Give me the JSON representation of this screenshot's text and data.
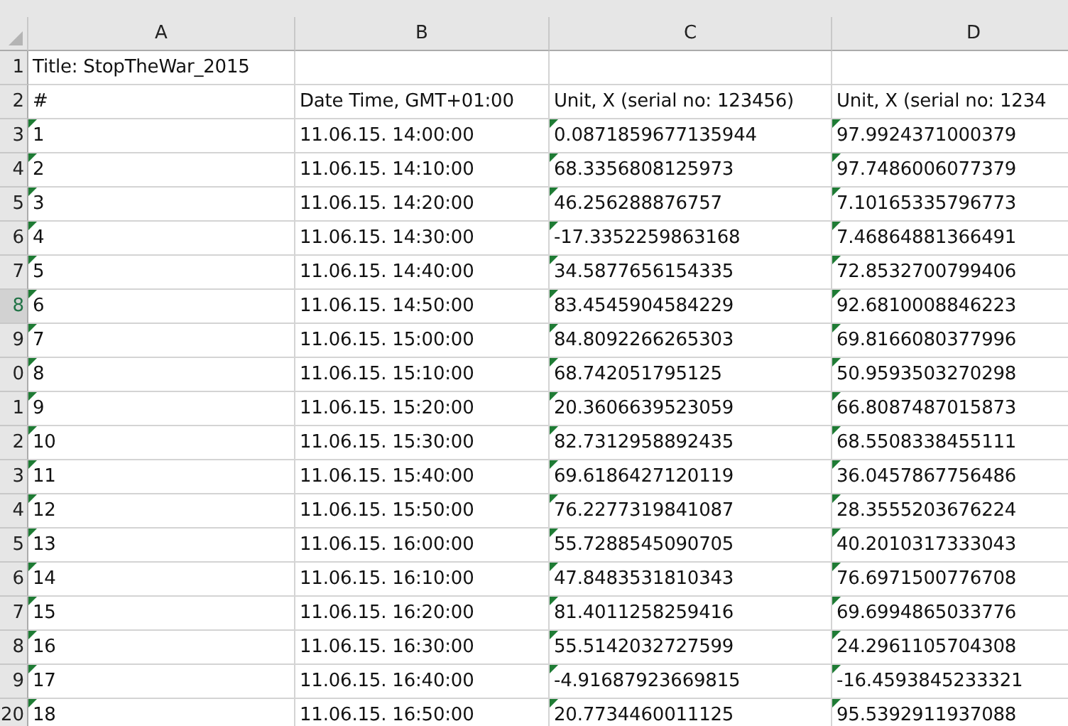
{
  "columns": [
    {
      "label": "A"
    },
    {
      "label": "B"
    },
    {
      "label": "C"
    },
    {
      "label": "D"
    }
  ],
  "rows": [
    {
      "header": "1",
      "selected": false,
      "flagged": false,
      "cells": [
        "Title: StopTheWar_2015",
        "",
        "",
        ""
      ]
    },
    {
      "header": "2",
      "selected": false,
      "flagged": false,
      "cells": [
        "#",
        "Date Time, GMT+01:00",
        "Unit, X (serial no: 123456)",
        "Unit, X (serial no: 1234"
      ]
    },
    {
      "header": "3",
      "selected": false,
      "flagged": true,
      "cells": [
        "1",
        "11.06.15. 14:00:00",
        "0.0871859677135944",
        "97.9924371000379"
      ]
    },
    {
      "header": "4",
      "selected": false,
      "flagged": true,
      "cells": [
        "2",
        "11.06.15. 14:10:00",
        "68.3356808125973",
        "97.7486006077379"
      ]
    },
    {
      "header": "5",
      "selected": false,
      "flagged": true,
      "cells": [
        "3",
        "11.06.15. 14:20:00",
        "46.256288876757",
        "7.10165335796773"
      ]
    },
    {
      "header": "6",
      "selected": false,
      "flagged": true,
      "cells": [
        "4",
        "11.06.15. 14:30:00",
        "-17.3352259863168",
        "7.46864881366491"
      ]
    },
    {
      "header": "7",
      "selected": false,
      "flagged": true,
      "cells": [
        "5",
        "11.06.15. 14:40:00",
        "34.5877656154335",
        "72.8532700799406"
      ]
    },
    {
      "header": "8",
      "selected": true,
      "flagged": true,
      "cells": [
        "6",
        "11.06.15. 14:50:00",
        "83.4545904584229",
        "92.6810008846223"
      ]
    },
    {
      "header": "9",
      "selected": false,
      "flagged": true,
      "cells": [
        "7",
        "11.06.15. 15:00:00",
        "84.8092266265303",
        "69.8166080377996"
      ]
    },
    {
      "header": "0",
      "selected": false,
      "flagged": true,
      "cells": [
        "8",
        "11.06.15. 15:10:00",
        "68.742051795125",
        "50.9593503270298"
      ]
    },
    {
      "header": "1",
      "selected": false,
      "flagged": true,
      "cells": [
        "9",
        "11.06.15. 15:20:00",
        "20.3606639523059",
        "66.8087487015873"
      ]
    },
    {
      "header": "2",
      "selected": false,
      "flagged": true,
      "cells": [
        "10",
        "11.06.15. 15:30:00",
        "82.7312958892435",
        "68.5508338455111"
      ]
    },
    {
      "header": "3",
      "selected": false,
      "flagged": true,
      "cells": [
        "11",
        "11.06.15. 15:40:00",
        "69.6186427120119",
        "36.0457867756486"
      ]
    },
    {
      "header": "4",
      "selected": false,
      "flagged": true,
      "cells": [
        "12",
        "11.06.15. 15:50:00",
        "76.2277319841087",
        "28.3555203676224"
      ]
    },
    {
      "header": "5",
      "selected": false,
      "flagged": true,
      "cells": [
        "13",
        "11.06.15. 16:00:00",
        "55.7288545090705",
        "40.2010317333043"
      ]
    },
    {
      "header": "6",
      "selected": false,
      "flagged": true,
      "cells": [
        "14",
        "11.06.15. 16:10:00",
        "47.8483531810343",
        "76.6971500776708"
      ]
    },
    {
      "header": "7",
      "selected": false,
      "flagged": true,
      "cells": [
        "15",
        "11.06.15. 16:20:00",
        "81.4011258259416",
        "69.6994865033776"
      ]
    },
    {
      "header": "8",
      "selected": false,
      "flagged": true,
      "cells": [
        "16",
        "11.06.15. 16:30:00",
        "55.5142032727599",
        "24.2961105704308"
      ]
    },
    {
      "header": "9",
      "selected": false,
      "flagged": true,
      "cells": [
        "17",
        "11.06.15. 16:40:00",
        "-4.91687923669815",
        "-16.4593845233321"
      ]
    },
    {
      "header": "20",
      "selected": false,
      "flagged": true,
      "cells": [
        "18",
        "11.06.15. 16:50:00",
        "20.7734460011125",
        "95.5392911937088"
      ]
    }
  ]
}
